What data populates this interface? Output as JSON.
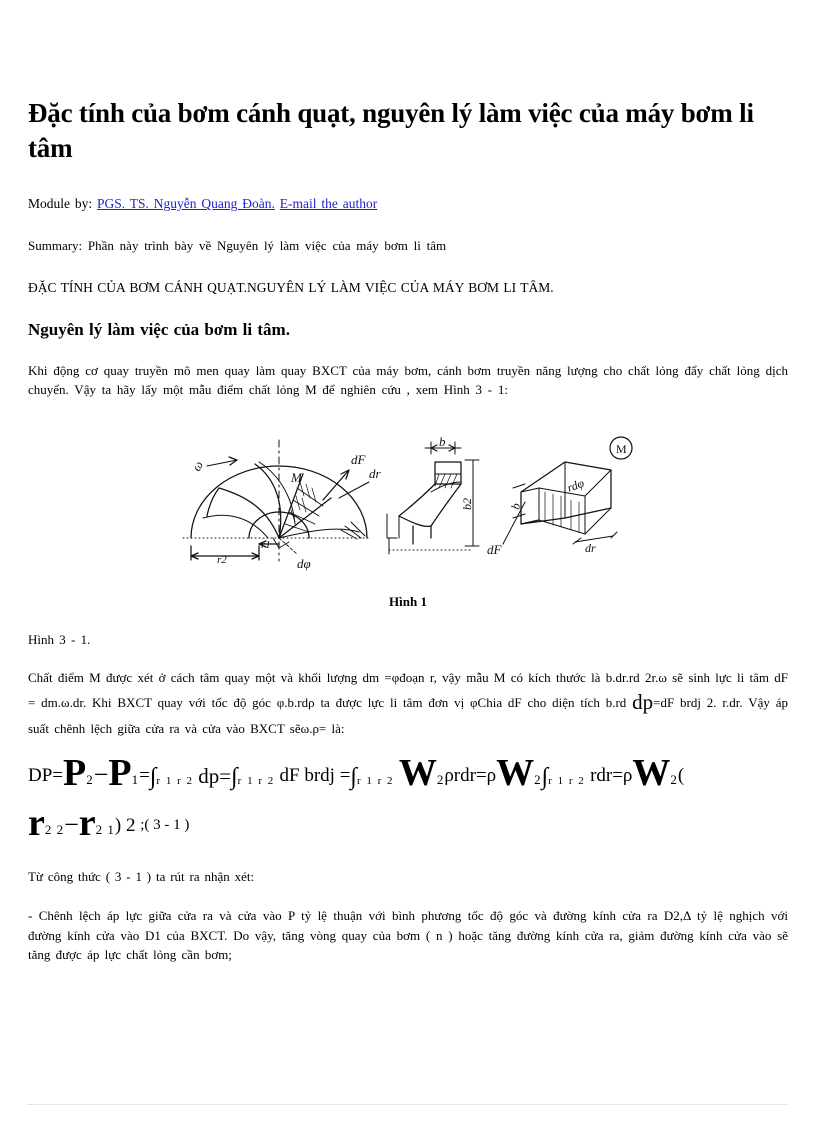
{
  "document": {
    "title": "Đặc tính của bơm cánh quạt, nguyên lý làm việc của máy bơm li tâm",
    "byline_prefix": "Module by:",
    "author_link": "PGS. TS. Nguyễn Quang Đoàn.",
    "email_link": "E-mail the author",
    "summary_label": "Summary:",
    "summary_text": "Phần này trình bày về Nguyên lý làm việc của máy bơm li tâm",
    "caps_line": "ĐẶC TÍNH CỦA BƠM CÁNH QUẠT.NGUYÊN LÝ LÀM VIỆC CỦA MÁY BƠM LI TÂM.",
    "section_heading": "Nguyên lý làm việc của bơm li tâm.",
    "intro_paragraph": "Khi động cơ quay truyền mô men quay làm quay BXCT của máy bơm, cánh bơm truyền năng lượng cho chất lỏng đẩy chất lỏng dịch chuyển. Vậy ta hãy lấy một mẫu điểm chất lỏng M để nghiên cứu , xem Hình 3 - 1:",
    "figure_caption": "Hình 1",
    "figure_reference": "Hình 3 - 1.",
    "body_line_1": "Chất điểm M được xét ở cách tâm quay một  và khối lượng dm =φđoạn r, vậy mẫu M có kích thước là b.dr.rd 2r.ω sẽ",
    "body_line_2": "sinh lực li tâm dF = dm.ω.dr. Khi BXCT quay với tốc độ góc φ.b.rdρ ta được lực li tâm đơn vị φChia dF cho diện tích",
    "body_line_3_pre": "b.rd ",
    "body_line_3_big": "dp",
    "body_line_3_post": "=dF brdj    2. r.dr. Vậy áp suất chênh lệch giữa cửa ra và cửa vào BXCT sẽω.ρ= là:",
    "conclusion_intro": "Từ công thức ( 3 - 1 ) ta rút ra nhận xét:",
    "conclusion_paragraph": "- Chênh lệch áp lực giữa cửa ra và cửa vào P tỷ lệ thuận với bình phương tốc độ góc và đường kính cửa ra D2,Δ tỷ lệ nghịch với đường kính cửa vào D1 của BXCT. Do vậy, tăng vòng quay của bơm ( n ) hoặc tăng đường kính cửa ra, giảm đường kính cửa vào sẽ tăng được áp lực chất lỏng cần bơm;"
  },
  "formula": {
    "line1": {
      "lhs": "DP=",
      "p_symbol_1": "P",
      "sub_1": "2",
      "minus": "−",
      "p_symbol_2": "P",
      "sub_2": "1",
      "eq_1": "=",
      "int_1": "∫",
      "bounds_1": "r 1  r 2",
      "dp_1": "dp=",
      "int_2": "∫",
      "bounds_2": "r 1  r 2",
      "dfbrdj": "dF brdj",
      "eq_2": "=",
      "int_3": "∫",
      "bounds_3": "r 1  r 2",
      "w_symbol_1": "W",
      "w_sub_1": "2",
      "prdr": "ρrdr=ρ",
      "w_symbol_2": "W",
      "w_sub_2": "2",
      "int_4": "∫",
      "bounds_4": "r 1  r 2",
      "rdr": "rdr=ρ",
      "w_symbol_3": "W",
      "w_sub_3": "2",
      "open_paren": "("
    },
    "line2": {
      "r_symbol_1": "r",
      "sub_1": "2 2",
      "minus": "−",
      "r_symbol_2": "r",
      "sub_2": "2 1",
      "close": ") 2",
      "tag": ";( 3 - 1 )"
    }
  },
  "figure": {
    "labels": {
      "omega": "ω",
      "dF": "dF",
      "dr": "dr",
      "M": "M",
      "r1": "r1",
      "r2": "r2",
      "dphi": "dφ",
      "b": "b",
      "b2": "b2",
      "rdphi": "rdφ",
      "dr2": "dr",
      "M_circle": "M"
    }
  },
  "colors": {
    "text": "#000000",
    "link": "#2222cc",
    "background": "#ffffff",
    "rule": "#9aa6d6"
  }
}
